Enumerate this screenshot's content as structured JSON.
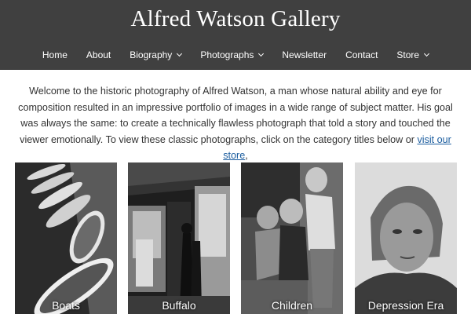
{
  "header": {
    "title": "Alfred Watson Gallery"
  },
  "nav": [
    {
      "label": "Home",
      "dropdown": false
    },
    {
      "label": "About",
      "dropdown": false
    },
    {
      "label": "Biography",
      "dropdown": true
    },
    {
      "label": "Photographs",
      "dropdown": true
    },
    {
      "label": "Newsletter",
      "dropdown": false
    },
    {
      "label": "Contact",
      "dropdown": false
    },
    {
      "label": "Store",
      "dropdown": true
    }
  ],
  "intro": {
    "text": "Welcome to the historic photography of Alfred Watson, a man whose natural ability and eye for composition resulted in an impressive portfolio of images in a wide range of subject matter.  His goal was always the same: to create a technically flawless photograph that told a story and touched the viewer emotionally. To view these classic photographs, click on the category titles below or ",
    "link_text": "visit our store",
    "trailing": ","
  },
  "categories": [
    {
      "label": "Boats"
    },
    {
      "label": "Buffalo"
    },
    {
      "label": "Children"
    },
    {
      "label": "Depression Era"
    }
  ],
  "colors": {
    "header_bg": "#404040",
    "link": "#1a5c9e"
  }
}
